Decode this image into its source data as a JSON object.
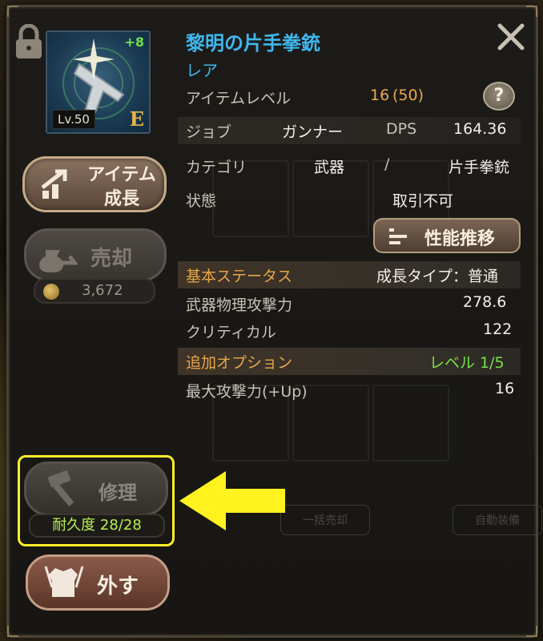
{
  "item": {
    "name": "黎明の片手拳銃",
    "rarity": "レア",
    "enhance": "+8",
    "level_badge": "Lv.50",
    "equipped_mark": "E"
  },
  "info": {
    "item_level_label": "アイテムレベル",
    "item_level_value": "16",
    "item_level_max": "(50)",
    "job_label": "ジョブ",
    "job_value": "ガンナー",
    "dps_label": "DPS",
    "dps_value": "164.36",
    "category_label": "カテゴリ",
    "category_main": "武器",
    "category_sep": "/",
    "category_sub": "片手拳銃",
    "state_label": "状態",
    "state_value": "取引不可"
  },
  "buttons": {
    "help": "?",
    "performance": "性能推移",
    "grow_line1": "アイテム",
    "grow_line2": "成長",
    "sell": "売却",
    "sell_price": "3,672",
    "repair": "修理",
    "durability": "耐久度 28/28",
    "unequip": "外す"
  },
  "base_stats": {
    "title": "基本ステータス",
    "growth_type": "成長タイプ：普通",
    "rows": [
      {
        "label": "武器物理攻撃力",
        "value": "278.6"
      },
      {
        "label": "クリティカル",
        "value": "122"
      }
    ]
  },
  "extra_options": {
    "title": "追加オプション",
    "level": "レベル 1/5",
    "rows": [
      {
        "label": "最大攻撃力(+Up)",
        "value": "16"
      }
    ]
  },
  "background": {
    "bulk_sell": "一括売却",
    "auto_equip": "自動装備"
  },
  "colors": {
    "name_blue": "#3fb7ee",
    "highlight_yellow": "#ffee2a",
    "green_text": "#79e048",
    "section_orange": "#e7a64b"
  }
}
